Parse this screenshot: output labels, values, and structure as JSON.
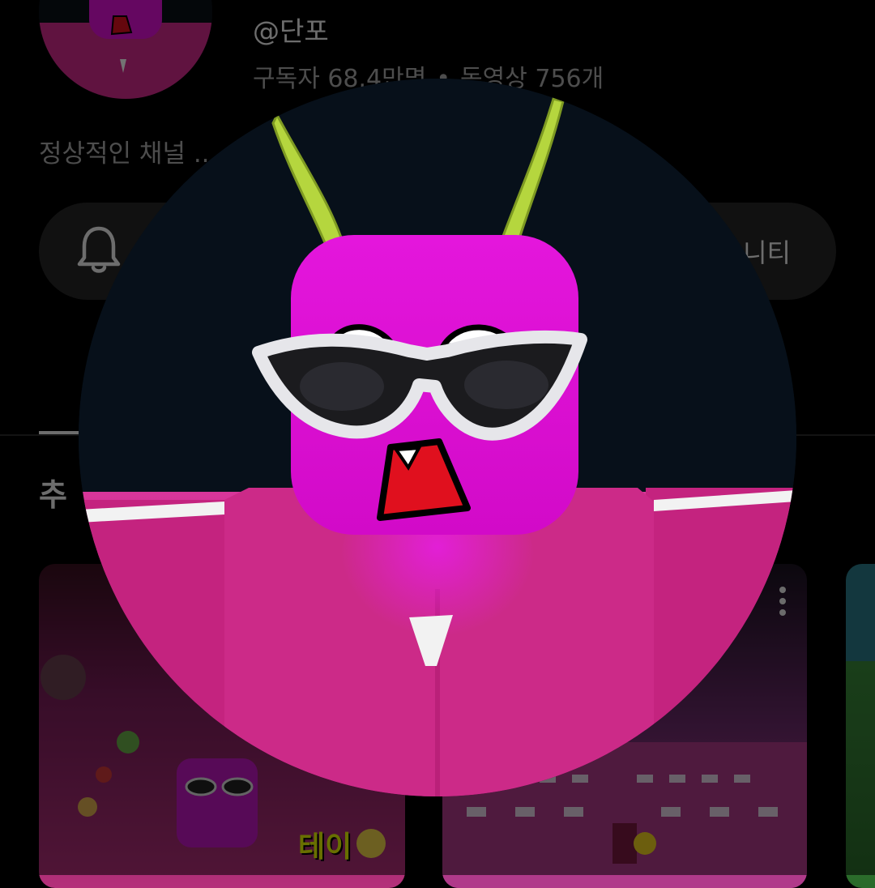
{
  "channel": {
    "handle": "@단포",
    "subscribers": "구독자 68.4만명",
    "separator": "•",
    "videos": "동영상 756개",
    "description": "정상적인 채널 .."
  },
  "actions": {
    "bell_icon": "bell-icon",
    "community_label": "니티"
  },
  "section": {
    "title": "추"
  },
  "thumbnails": [
    {
      "overlay_text": "테이"
    },
    {
      "overlay_text": ""
    }
  ],
  "colors": {
    "background": "#000000",
    "pill": "#272727",
    "avatar_head": "#e010d8",
    "avatar_body": "#d42a8e",
    "mouth": "#e01020",
    "antenna": "#b4d83c"
  }
}
